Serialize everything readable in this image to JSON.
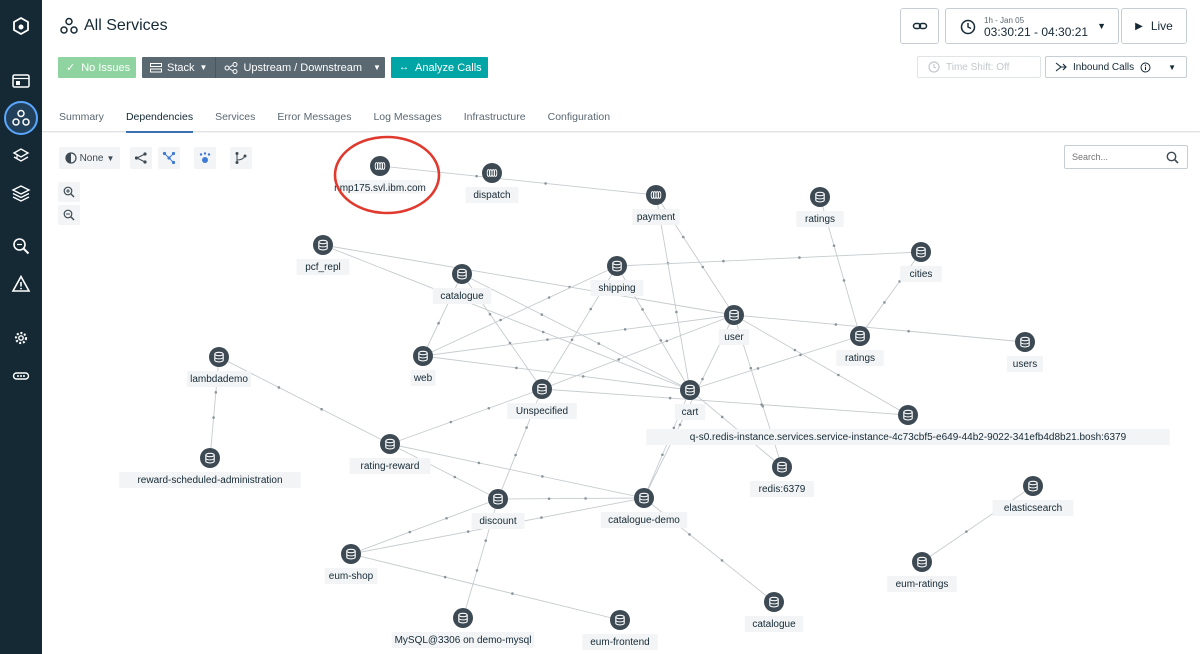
{
  "page": {
    "title": "All Services"
  },
  "toolbar": {
    "no_issues_label": "No Issues",
    "stack_label": "Stack",
    "upstream_label": "Upstream / Downstream",
    "analyze_label": "Analyze Calls",
    "time_small": "1h - Jan 05",
    "time_main": "03:30:21 - 04:30:21",
    "live_label": "Live",
    "timeshift_label": "Time Shift: Off",
    "inbound_label": "Inbound Calls"
  },
  "tabs": [
    {
      "label": "Summary"
    },
    {
      "label": "Dependencies"
    },
    {
      "label": "Services"
    },
    {
      "label": "Error Messages"
    },
    {
      "label": "Log Messages"
    },
    {
      "label": "Infrastructure"
    },
    {
      "label": "Configuration"
    }
  ],
  "graph": {
    "group_by": "None",
    "search_placeholder": "Search...",
    "highlight_color": "#e03a2f",
    "nodes": [
      {
        "id": "nmp",
        "label": "nmp175.svl.ibm.com",
        "kind": "host",
        "highlight": true
      },
      {
        "id": "dispatch",
        "label": "dispatch",
        "kind": "queue"
      },
      {
        "id": "payment",
        "label": "payment",
        "kind": "queue"
      },
      {
        "id": "ratings_top",
        "label": "ratings",
        "kind": "db"
      },
      {
        "id": "pcf_repl",
        "label": "pcf_repl",
        "kind": "db"
      },
      {
        "id": "catalogue1",
        "label": "catalogue",
        "kind": "db"
      },
      {
        "id": "shipping",
        "label": "shipping",
        "kind": "db"
      },
      {
        "id": "cities",
        "label": "cities",
        "kind": "db"
      },
      {
        "id": "user",
        "label": "user",
        "kind": "db"
      },
      {
        "id": "ratings_mid",
        "label": "ratings",
        "kind": "db"
      },
      {
        "id": "users",
        "label": "users",
        "kind": "db"
      },
      {
        "id": "lambdademo",
        "label": "lambdademo",
        "kind": "db"
      },
      {
        "id": "web",
        "label": "web",
        "kind": "db"
      },
      {
        "id": "unspecified",
        "label": "Unspecified",
        "kind": "db"
      },
      {
        "id": "cart",
        "label": "cart",
        "kind": "db"
      },
      {
        "id": "redis_instance",
        "label": "q-s0.redis-instance.services.service-instance-4c73cbf5-e649-44b2-9022-341efb4d8b21.bosh:6379",
        "kind": "db"
      },
      {
        "id": "rating_reward",
        "label": "rating-reward",
        "kind": "db"
      },
      {
        "id": "reward_admin",
        "label": "reward-scheduled-administration",
        "kind": "db"
      },
      {
        "id": "redis6379",
        "label": "redis:6379",
        "kind": "db"
      },
      {
        "id": "discount",
        "label": "discount",
        "kind": "db"
      },
      {
        "id": "catalogue_demo",
        "label": "catalogue-demo",
        "kind": "db"
      },
      {
        "id": "elasticsearch",
        "label": "elasticsearch",
        "kind": "db"
      },
      {
        "id": "eum_shop",
        "label": "eum-shop",
        "kind": "db"
      },
      {
        "id": "eum_ratings",
        "label": "eum-ratings",
        "kind": "db"
      },
      {
        "id": "mysql",
        "label": "MySQL@3306 on demo-mysql",
        "kind": "db"
      },
      {
        "id": "eum_frontend",
        "label": "eum-frontend",
        "kind": "db"
      },
      {
        "id": "catalogue2",
        "label": "catalogue",
        "kind": "db"
      }
    ],
    "edges": [
      [
        "nmp",
        "payment"
      ],
      [
        "payment",
        "user"
      ],
      [
        "payment",
        "cart"
      ],
      [
        "ratings_top",
        "ratings_mid"
      ],
      [
        "pcf_repl",
        "user"
      ],
      [
        "pcf_repl",
        "cart"
      ],
      [
        "catalogue1",
        "cart"
      ],
      [
        "catalogue1",
        "web"
      ],
      [
        "catalogue1",
        "unspecified"
      ],
      [
        "shipping",
        "cities"
      ],
      [
        "shipping",
        "cart"
      ],
      [
        "shipping",
        "web"
      ],
      [
        "shipping",
        "unspecified"
      ],
      [
        "user",
        "users"
      ],
      [
        "user",
        "web"
      ],
      [
        "user",
        "unspecified"
      ],
      [
        "user",
        "catalogue_demo"
      ],
      [
        "user",
        "redis_instance"
      ],
      [
        "user",
        "redis6379"
      ],
      [
        "cities",
        "ratings_mid"
      ],
      [
        "ratings_mid",
        "cart"
      ],
      [
        "web",
        "cart"
      ],
      [
        "unspecified",
        "redis_instance"
      ],
      [
        "unspecified",
        "rating_reward"
      ],
      [
        "unspecified",
        "discount"
      ],
      [
        "cart",
        "catalogue_demo"
      ],
      [
        "cart",
        "redis6379"
      ],
      [
        "lambdademo",
        "reward_admin"
      ],
      [
        "lambdademo",
        "rating_reward"
      ],
      [
        "rating_reward",
        "catalogue_demo"
      ],
      [
        "rating_reward",
        "discount"
      ],
      [
        "discount",
        "catalogue_demo"
      ],
      [
        "discount",
        "eum_shop"
      ],
      [
        "discount",
        "mysql"
      ],
      [
        "catalogue_demo",
        "catalogue2"
      ],
      [
        "catalogue_demo",
        "eum_shop"
      ],
      [
        "eum_shop",
        "eum_frontend"
      ],
      [
        "elasticsearch",
        "eum_ratings"
      ]
    ]
  }
}
